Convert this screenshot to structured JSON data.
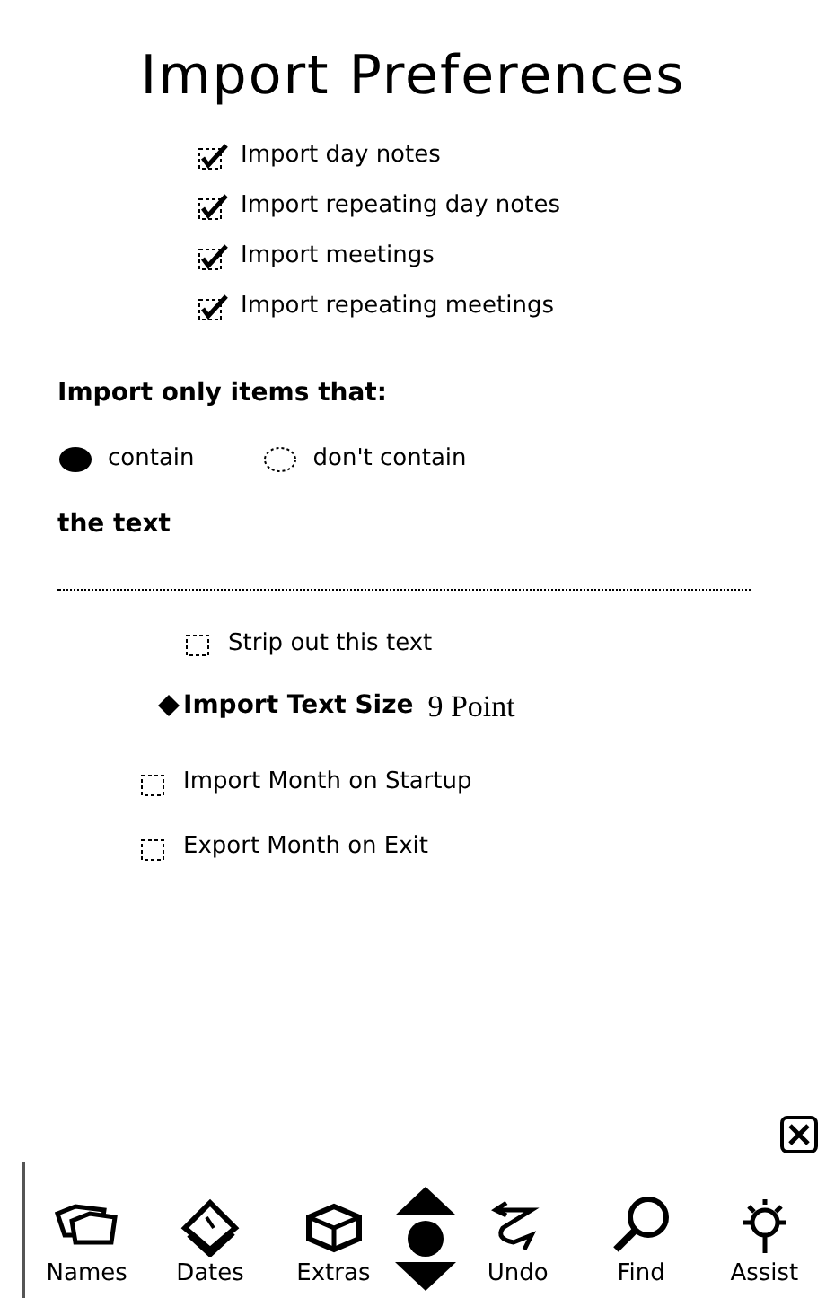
{
  "title": "Import Preferences",
  "import_options": [
    {
      "label": "Import day notes",
      "checked": true
    },
    {
      "label": "Import repeating day notes",
      "checked": true
    },
    {
      "label": "Import meetings",
      "checked": true
    },
    {
      "label": "Import repeating meetings",
      "checked": true
    }
  ],
  "filter": {
    "heading": "Import only items that:",
    "choices": [
      {
        "label": "contain",
        "selected": true
      },
      {
        "label": "don't contain",
        "selected": false
      }
    ],
    "text_label": "the text",
    "strip": {
      "label": "Strip out this text",
      "checked": false
    }
  },
  "text_size": {
    "label": "Import Text Size",
    "value": "9 Point"
  },
  "month_options": [
    {
      "label": "Import Month on Startup",
      "checked": false
    },
    {
      "label": "Export Month on Exit",
      "checked": false
    }
  ],
  "toolbar": [
    {
      "kind": "names",
      "label": "Names"
    },
    {
      "kind": "dates",
      "label": "Dates"
    },
    {
      "kind": "extras",
      "label": "Extras"
    },
    {
      "kind": "scroll"
    },
    {
      "kind": "undo",
      "label": "Undo"
    },
    {
      "kind": "find",
      "label": "Find"
    },
    {
      "kind": "assist",
      "label": "Assist"
    }
  ]
}
